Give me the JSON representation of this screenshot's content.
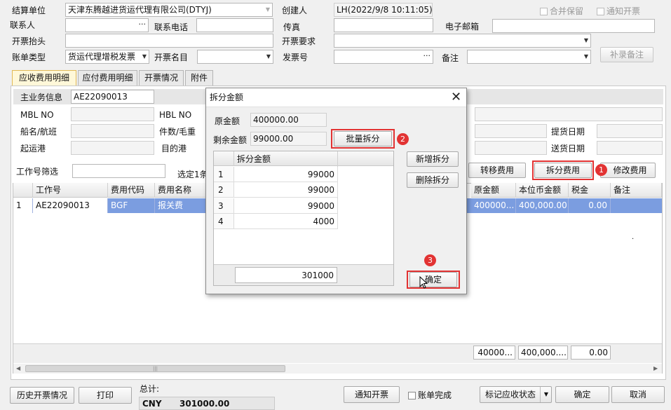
{
  "form": {
    "settle_label": "结算单位",
    "settle_value": "天津东腾越进货运代理有限公司(DTYJ)",
    "creator_label": "创建人",
    "creator_value": "LH(2022/9/8 10:11:05)",
    "merge_label": "合并保留",
    "notify_label": "通知开票",
    "contact_label": "联系人",
    "phone_label": "联系电话",
    "fax_label": "传真",
    "email_label": "电子邮箱",
    "invoice_title_label": "开票抬头",
    "invoice_req_label": "开票要求",
    "bill_type_label": "账单类型",
    "bill_type_value": "货运代理增税发票",
    "invoice_item_label": "开票名目",
    "invoice_no_label": "发票号",
    "remark_label": "备注",
    "add_remark_button": "补录备注"
  },
  "tabs": [
    "应收费用明细",
    "应付费用明细",
    "开票情况",
    "附件"
  ],
  "info": {
    "main_label": "主业务信息",
    "main_value": "AE22090013",
    "mbl_label": "MBL NO",
    "hbl_label": "HBL NO",
    "vessel_label": "船名/航班",
    "pieces_label": "件数/毛重",
    "pickup_label": "提货日期",
    "origin_label": "起运港",
    "dest_label": "目的港",
    "delivery_label": "送货日期"
  },
  "filter": {
    "job_filter_label": "工作号筛选",
    "selected_text": "选定1条",
    "transfer_button": "转移费用",
    "split_button": "拆分费用",
    "modify_button": "修改费用"
  },
  "grid": {
    "headers": [
      "工作号",
      "费用代码",
      "费用名称",
      "原金额",
      "本位币金额",
      "税金",
      "备注"
    ],
    "row": {
      "index": "1",
      "job": "AE22090013",
      "code": "BGF",
      "name": "报关费",
      "orig": "400000...",
      "local": "400,000.00",
      "tax": "0.00"
    },
    "totals": {
      "orig": "40000...",
      "local": "400,000....",
      "tax": "0.00"
    }
  },
  "dialog": {
    "title": "拆分金额",
    "orig_label": "原金额",
    "orig_value": "400000.00",
    "remain_label": "剩余金额",
    "remain_value": "99000.00",
    "batch_button": "批量拆分",
    "col_header": "拆分金额",
    "rows": [
      {
        "index": "1",
        "amount": "99000"
      },
      {
        "index": "2",
        "amount": "99000"
      },
      {
        "index": "3",
        "amount": "99000"
      },
      {
        "index": "4",
        "amount": "4000"
      }
    ],
    "total": "301000",
    "add_button": "新增拆分",
    "delete_button": "删除拆分",
    "ok_button": "确定"
  },
  "badges": [
    "1",
    "2",
    "3"
  ],
  "footer": {
    "history_button": "历史开票情况",
    "print_button": "打印",
    "total_label": "总计:",
    "currency": "CNY",
    "total_value": "301000.00",
    "notify_button": "通知开票",
    "complete_label": "账单完成",
    "mark_button": "标记应收状态",
    "ok_button": "确定",
    "cancel_button": "取消"
  },
  "colors": {
    "accent_red": "#e23333",
    "selection": "#7b9de0"
  }
}
